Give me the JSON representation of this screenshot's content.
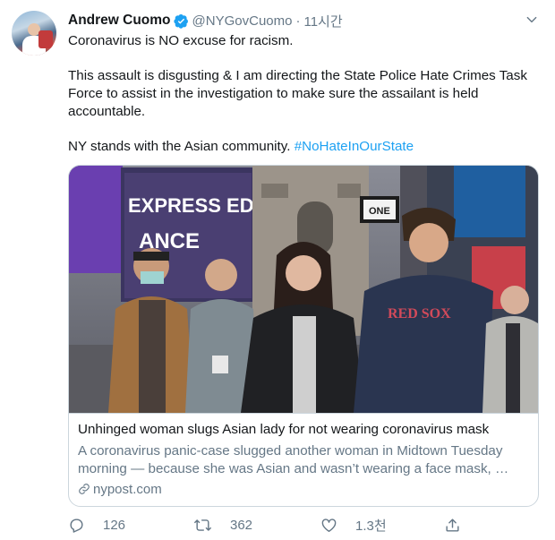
{
  "tweet": {
    "author_name": "Andrew Cuomo",
    "handle": "@NYGovCuomo",
    "separator": "·",
    "time": "11시간",
    "verified": true,
    "lines": [
      "Coronavirus is NO excuse for racism.",
      "This assault is disgusting & I am directing the State Police Hate Crimes Task Force to assist in the investigation to make sure the assailant is held accountable.",
      "NY stands with the Asian community. "
    ],
    "hashtag": "#NoHateInOurState"
  },
  "card": {
    "image_signs": {
      "sign_express": "EXPRESS EDIT",
      "sign_ance": "ANCE",
      "sign_one": "ONE",
      "shirt_logo": "RED SOX"
    },
    "title": "Unhinged woman slugs Asian lady for not wearing coronavirus mask",
    "description": "A coronavirus panic-case slugged another woman in Midtown Tuesday morning — because she was Asian and wasn’t wearing a face mask, …",
    "domain": "nypost.com"
  },
  "actions": {
    "replies": "126",
    "retweets": "362",
    "likes": "1.3천"
  },
  "icons": {
    "verified": "verified-badge-icon",
    "caret": "chevron-down-icon",
    "reply": "reply-icon",
    "retweet": "retweet-icon",
    "like": "heart-icon",
    "share": "share-icon",
    "link": "link-icon"
  },
  "colors": {
    "accent": "#1da1f2",
    "text": "#14171a",
    "secondary": "#657786",
    "border": "#ccd6dd"
  }
}
